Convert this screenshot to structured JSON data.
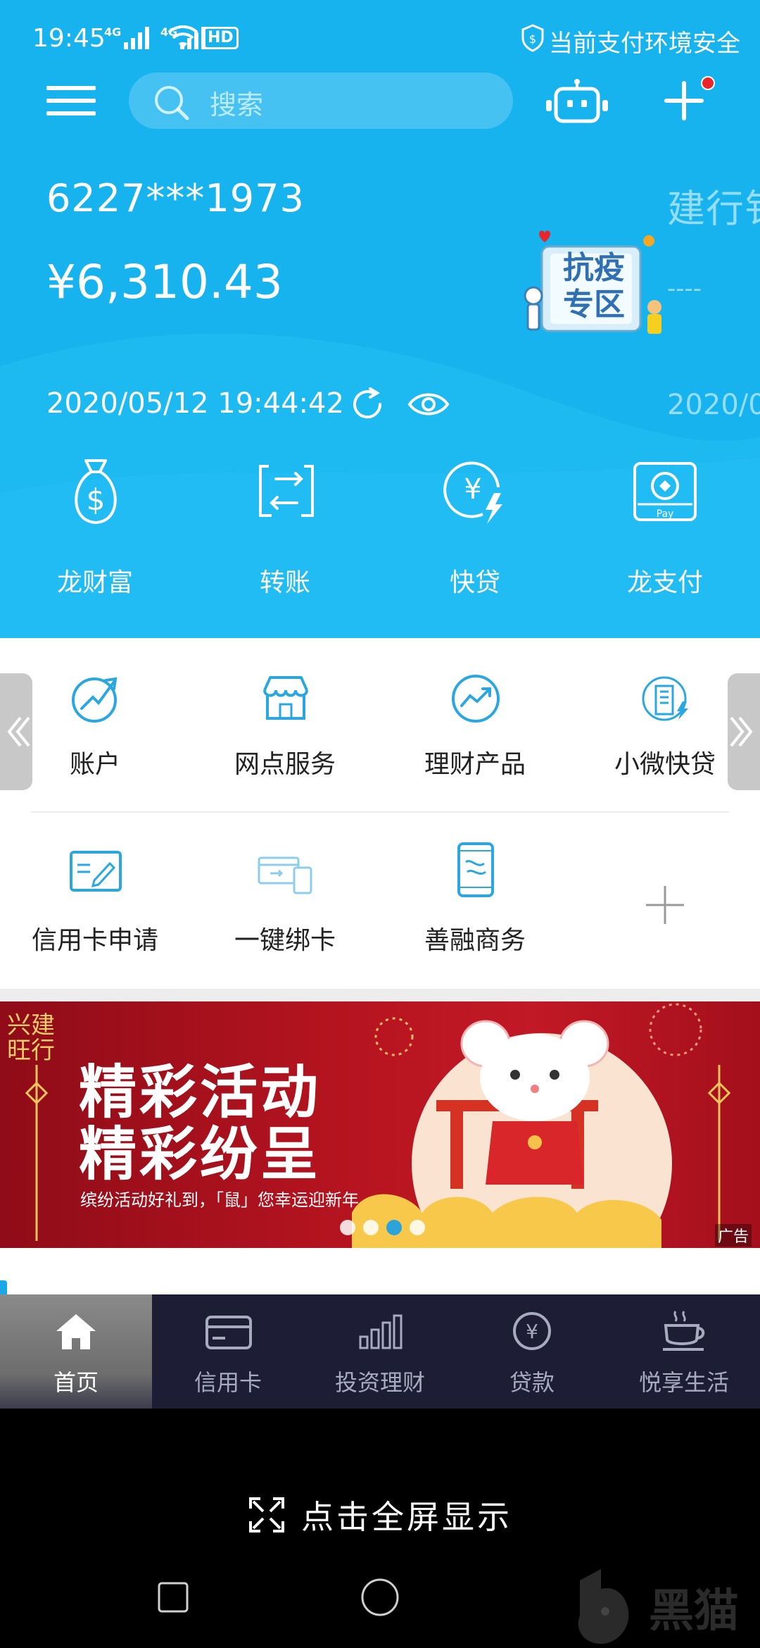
{
  "status_bar": {
    "time": "19:45",
    "net1": "4G",
    "net2": "4G",
    "hd": "HD",
    "security_text": "当前支付环境安全"
  },
  "search": {
    "placeholder": "搜索"
  },
  "account": {
    "card_number": "6227***1973",
    "balance": "¥6,310.43",
    "timestamp": "2020/05/12 19:44:42",
    "next_card_bank_partial": "建行钅",
    "next_card_time_partial": "2020/0",
    "next_card_dash": "----"
  },
  "epidemic_badge": {
    "line1": "抗疫",
    "line2": "专区"
  },
  "quick_actions": [
    {
      "label": "龙财富",
      "icon": "money-bag-icon"
    },
    {
      "label": "转账",
      "icon": "transfer-icon"
    },
    {
      "label": "快贷",
      "icon": "quick-loan-icon"
    },
    {
      "label": "龙支付",
      "icon": "long-pay-icon"
    }
  ],
  "pay_badge": "Pay",
  "grid_row1": [
    {
      "label": "账户",
      "icon": "account-trend-icon"
    },
    {
      "label": "网点服务",
      "icon": "branch-store-icon"
    },
    {
      "label": "理财产品",
      "icon": "wealth-chart-icon"
    },
    {
      "label": "小微快贷",
      "icon": "building-bolt-icon"
    }
  ],
  "grid_row2": [
    {
      "label": "信用卡申请",
      "icon": "card-application-icon"
    },
    {
      "label": "一键绑卡",
      "icon": "bind-card-icon"
    },
    {
      "label": "善融商务",
      "icon": "mobile-commerce-icon"
    }
  ],
  "banner": {
    "corner_text": "兴建旺行",
    "title1": "精彩活动",
    "title2": "精彩纷呈",
    "subtitle": "缤纷活动好礼到，「鼠」您幸运迎新年",
    "ad_label": "广告",
    "slides_total": 4,
    "active_slide": 3
  },
  "tabbar": [
    {
      "label": "首页",
      "icon": "home-icon",
      "active": true
    },
    {
      "label": "信用卡",
      "icon": "credit-card-icon",
      "active": false
    },
    {
      "label": "投资理财",
      "icon": "bar-chart-icon",
      "active": false
    },
    {
      "label": "贷款",
      "icon": "yuan-circle-icon",
      "active": false
    },
    {
      "label": "悦享生活",
      "icon": "coffee-cup-icon",
      "active": false
    }
  ],
  "fullscreen_hint": "点击全屏显示",
  "watermark": "黑猫",
  "colors": {
    "header_blue": "#17b3ef",
    "tabbar_bg": "#1d1e36",
    "banner_red": "#b5141f",
    "icon_teal": "#2aa7e0"
  }
}
